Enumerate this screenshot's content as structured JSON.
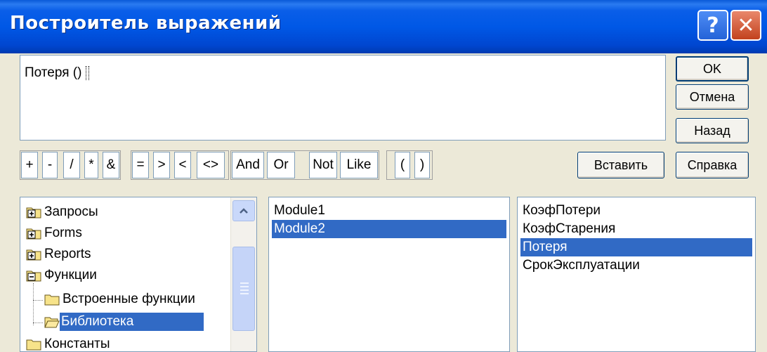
{
  "window": {
    "title": "Построитель выражений",
    "help_glyph": "?",
    "close_glyph": "✕"
  },
  "expression": {
    "text": "Потеря () "
  },
  "buttons": {
    "ok": "OK",
    "cancel": "Отмена",
    "back": "Назад",
    "paste": "Вставить",
    "help": "Справка"
  },
  "operators": [
    {
      "label": "+"
    },
    {
      "label": "-"
    },
    {
      "label": "/"
    },
    {
      "label": "*"
    },
    {
      "label": "&"
    },
    {
      "label": "="
    },
    {
      "label": ">"
    },
    {
      "label": "<"
    },
    {
      "label": "<>"
    },
    {
      "label": "And"
    },
    {
      "label": "Or"
    },
    {
      "label": "Not"
    },
    {
      "label": "Like"
    },
    {
      "label": "("
    },
    {
      "label": ")"
    }
  ],
  "tree": {
    "items": [
      {
        "label": "Запросы",
        "icon": "folder-plus-icon"
      },
      {
        "label": "Forms",
        "icon": "folder-plus-icon"
      },
      {
        "label": "Reports",
        "icon": "folder-plus-icon"
      },
      {
        "label": "Функции",
        "icon": "folder-minus-icon"
      },
      {
        "label": "Встроенные функции",
        "icon": "folder-closed-icon"
      },
      {
        "label": "Библиотека",
        "icon": "folder-open-icon",
        "selected": true
      },
      {
        "label": "Константы",
        "icon": "folder-closed-icon"
      }
    ]
  },
  "modules": [
    {
      "label": "Module1"
    },
    {
      "label": "Module2",
      "selected": true
    }
  ],
  "members": [
    {
      "label": "КоэфПотери"
    },
    {
      "label": "КоэфСтарения"
    },
    {
      "label": "Потеря",
      "selected": true
    },
    {
      "label": "СрокЭксплуатации"
    }
  ],
  "colors": {
    "selection": "#316ac5",
    "titlebar": "#0058e6",
    "dialog_bg": "#ece9d8"
  }
}
